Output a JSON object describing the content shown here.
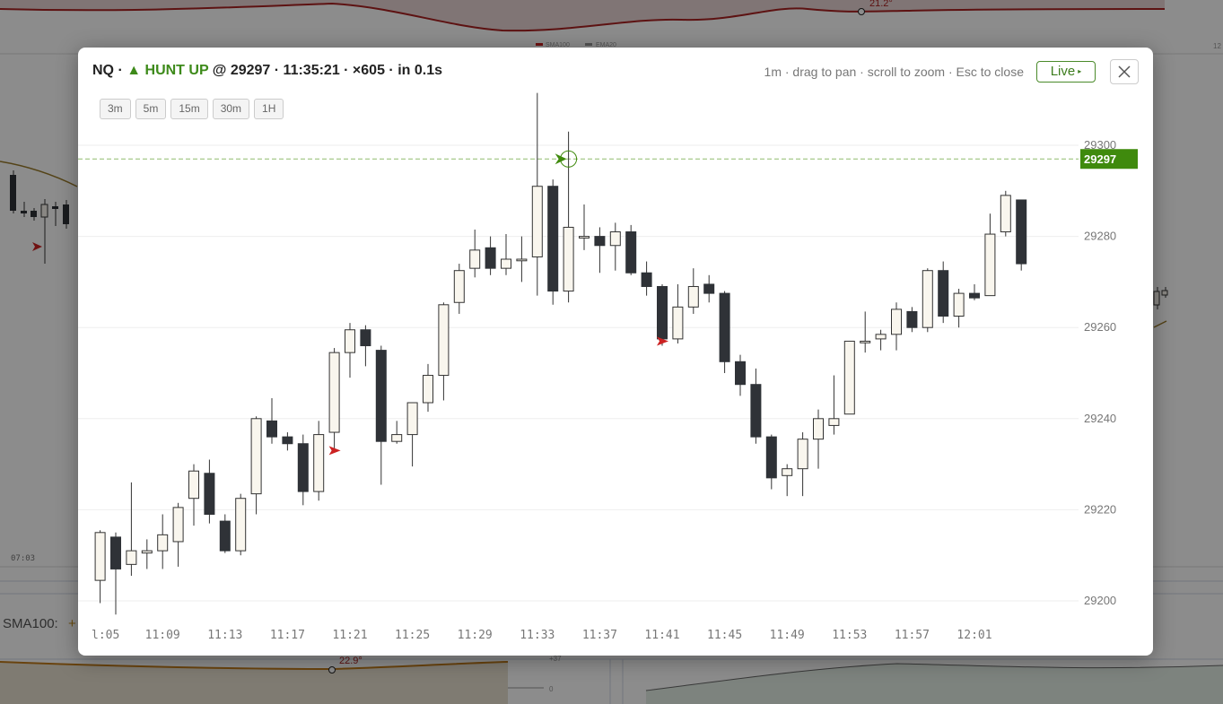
{
  "modal": {
    "symbol": "NQ",
    "dot1": " · ",
    "arrow": "▲",
    "signal": "HUNT UP",
    "price_part": " @ 29297 · 11:35:21 · ×605 · in 0.1s",
    "hint": "1m · drag to pan · scroll to zoom · Esc to close",
    "live_label": "Live",
    "live_icon": "▸",
    "close_icon": "close-icon",
    "timeframes": [
      "3m",
      "5m",
      "15m",
      "30m",
      "1H"
    ]
  },
  "background": {
    "sma_label": "SMA100:",
    "angle_top": "21.2°",
    "angle_bottom": "22.9°",
    "time_label": "07:03",
    "legend1": "SMA100",
    "legend2": "EMA20",
    "small_label": "12",
    "scale_val1": "+37",
    "scale_val2": "0"
  },
  "chart_data": {
    "type": "candlestick",
    "title": "",
    "interval": "1m",
    "y_ticks": [
      29300,
      29280,
      29260,
      29240,
      29220,
      29200
    ],
    "ylim": [
      29200,
      29300
    ],
    "x_tick_labels": [
      ":05",
      "11:09",
      "11:13",
      "11:17",
      "11:21",
      "11:25",
      "11:29",
      "11:33",
      "11:37",
      "11:41",
      "11:45",
      "11:49",
      "11:53",
      "11:57",
      "12:01"
    ],
    "first_x_tick_display": "l:05",
    "current_price": 29297,
    "current_price_label": "29297",
    "candles": [
      {
        "t": "11:05",
        "o": 29204.5,
        "h": 29215.5,
        "l": 29199.5,
        "c": 29215
      },
      {
        "t": "11:06",
        "o": 29214,
        "h": 29215,
        "l": 29197,
        "c": 29207
      },
      {
        "t": "11:07",
        "o": 29208,
        "h": 29226,
        "l": 29205.5,
        "c": 29211
      },
      {
        "t": "11:08",
        "o": 29210.5,
        "h": 29213.5,
        "l": 29207,
        "c": 29211
      },
      {
        "t": "11:09",
        "o": 29211,
        "h": 29219,
        "l": 29207,
        "c": 29214.5
      },
      {
        "t": "11:10",
        "o": 29213,
        "h": 29221.5,
        "l": 29207.5,
        "c": 29220.5
      },
      {
        "t": "11:11",
        "o": 29222.5,
        "h": 29230,
        "l": 29216.5,
        "c": 29228.5
      },
      {
        "t": "11:12",
        "o": 29228,
        "h": 29231,
        "l": 29217,
        "c": 29219
      },
      {
        "t": "11:13",
        "o": 29217.5,
        "h": 29219,
        "l": 29210.5,
        "c": 29211
      },
      {
        "t": "11:14",
        "o": 29211,
        "h": 29223.5,
        "l": 29210,
        "c": 29222.5
      },
      {
        "t": "11:15",
        "o": 29223.5,
        "h": 29240.5,
        "l": 29219,
        "c": 29240
      },
      {
        "t": "11:16",
        "o": 29239.5,
        "h": 29244.5,
        "l": 29234.5,
        "c": 29236
      },
      {
        "t": "11:17",
        "o": 29236,
        "h": 29237,
        "l": 29233,
        "c": 29234.5
      },
      {
        "t": "11:18",
        "o": 29234.5,
        "h": 29236.5,
        "l": 29221,
        "c": 29224
      },
      {
        "t": "11:19",
        "o": 29224,
        "h": 29239.5,
        "l": 29222,
        "c": 29236.5
      },
      {
        "t": "11:20",
        "o": 29237,
        "h": 29255.5,
        "l": 29233,
        "c": 29254.5
      },
      {
        "t": "11:21",
        "o": 29254.5,
        "h": 29261,
        "l": 29249,
        "c": 29259.5
      },
      {
        "t": "11:22",
        "o": 29259.5,
        "h": 29260.5,
        "l": 29251.5,
        "c": 29256
      },
      {
        "t": "11:23",
        "o": 29255,
        "h": 29256,
        "l": 29225.5,
        "c": 29235
      },
      {
        "t": "11:24",
        "o": 29235,
        "h": 29239.5,
        "l": 29234.5,
        "c": 29236.5
      },
      {
        "t": "11:25",
        "o": 29236.5,
        "h": 29241.5,
        "l": 29229.5,
        "c": 29243.5
      },
      {
        "t": "11:26",
        "o": 29243.5,
        "h": 29252,
        "l": 29241.5,
        "c": 29249.5
      },
      {
        "t": "11:27",
        "o": 29249.5,
        "h": 29265.5,
        "l": 29244,
        "c": 29265
      },
      {
        "t": "11:28",
        "o": 29265.5,
        "h": 29274,
        "l": 29263,
        "c": 29272.5
      },
      {
        "t": "11:29",
        "o": 29273,
        "h": 29281.5,
        "l": 29271,
        "c": 29277
      },
      {
        "t": "11:30",
        "o": 29277.5,
        "h": 29280,
        "l": 29271.5,
        "c": 29273
      },
      {
        "t": "11:31",
        "o": 29273,
        "h": 29280.5,
        "l": 29271.5,
        "c": 29275
      },
      {
        "t": "11:32",
        "o": 29275,
        "h": 29280,
        "l": 29270,
        "c": 29275
      },
      {
        "t": "11:33",
        "o": 29275.5,
        "h": 29311.5,
        "l": 29267,
        "c": 29291
      },
      {
        "t": "11:34",
        "o": 29291,
        "h": 29292.5,
        "l": 29265,
        "c": 29268
      },
      {
        "t": "11:35",
        "o": 29268,
        "h": 29303,
        "l": 29265.5,
        "c": 29282
      },
      {
        "t": "11:36",
        "o": 29280,
        "h": 29287,
        "l": 29277,
        "c": 29280
      },
      {
        "t": "11:37",
        "o": 29280,
        "h": 29282,
        "l": 29272,
        "c": 29278
      },
      {
        "t": "11:38",
        "o": 29278,
        "h": 29283,
        "l": 29272.5,
        "c": 29281
      },
      {
        "t": "11:39",
        "o": 29281,
        "h": 29282.5,
        "l": 29271.5,
        "c": 29272
      },
      {
        "t": "11:40",
        "o": 29272,
        "h": 29274.5,
        "l": 29267,
        "c": 29269
      },
      {
        "t": "11:41",
        "o": 29269,
        "h": 29269.5,
        "l": 29256,
        "c": 29257.5
      },
      {
        "t": "11:42",
        "o": 29257.5,
        "h": 29269.5,
        "l": 29256.5,
        "c": 29264.5
      },
      {
        "t": "11:43",
        "o": 29264.5,
        "h": 29273,
        "l": 29263,
        "c": 29269
      },
      {
        "t": "11:44",
        "o": 29269.5,
        "h": 29271.5,
        "l": 29265.5,
        "c": 29267.5
      },
      {
        "t": "11:45",
        "o": 29267.5,
        "h": 29268,
        "l": 29250,
        "c": 29252.5
      },
      {
        "t": "11:46",
        "o": 29252.5,
        "h": 29254,
        "l": 29245,
        "c": 29247.5
      },
      {
        "t": "11:47",
        "o": 29247.5,
        "h": 29251,
        "l": 29234.5,
        "c": 29236
      },
      {
        "t": "11:48",
        "o": 29236,
        "h": 29236.5,
        "l": 29224.5,
        "c": 29227
      },
      {
        "t": "11:49",
        "o": 29227.5,
        "h": 29230,
        "l": 29223,
        "c": 29229
      },
      {
        "t": "11:50",
        "o": 29229,
        "h": 29237,
        "l": 29223,
        "c": 29235.5
      },
      {
        "t": "11:51",
        "o": 29235.5,
        "h": 29242,
        "l": 29229,
        "c": 29240
      },
      {
        "t": "11:52",
        "o": 29238.5,
        "h": 29249.5,
        "l": 29236.5,
        "c": 29240
      },
      {
        "t": "11:53",
        "o": 29241,
        "h": 29257,
        "l": 29241,
        "c": 29257
      },
      {
        "t": "11:54",
        "o": 29257,
        "h": 29263.5,
        "l": 29254.5,
        "c": 29257
      },
      {
        "t": "11:55",
        "o": 29257.5,
        "h": 29259.5,
        "l": 29255,
        "c": 29258.5
      },
      {
        "t": "11:56",
        "o": 29258.5,
        "h": 29265.5,
        "l": 29255,
        "c": 29264
      },
      {
        "t": "11:57",
        "o": 29263.5,
        "h": 29264.5,
        "l": 29259,
        "c": 29260
      },
      {
        "t": "11:58",
        "o": 29260,
        "h": 29273,
        "l": 29259,
        "c": 29272.5
      },
      {
        "t": "11:59",
        "o": 29272.5,
        "h": 29274.5,
        "l": 29261,
        "c": 29262.5
      },
      {
        "t": "12:00",
        "o": 29262.5,
        "h": 29268.5,
        "l": 29260,
        "c": 29267.5
      },
      {
        "t": "12:01",
        "o": 29267.5,
        "h": 29269.5,
        "l": 29266,
        "c": 29266.5
      },
      {
        "t": "12:02",
        "o": 29267,
        "h": 29285,
        "l": 29267,
        "c": 29280.5
      },
      {
        "t": "12:03",
        "o": 29281,
        "h": 29290,
        "l": 29280,
        "c": 29289
      },
      {
        "t": "12:04",
        "o": 29288,
        "h": 29288,
        "l": 29272.5,
        "c": 29274
      }
    ],
    "markers": [
      {
        "t": "11:20",
        "price": 29233,
        "kind": "red-arrow"
      },
      {
        "t": "11:41",
        "price": 29257,
        "kind": "red-arrow"
      },
      {
        "t": "11:35",
        "price": 29297,
        "kind": "green-signal"
      }
    ],
    "colors": {
      "up_fill": "#f9f6ee",
      "down_fill": "#2f3237",
      "wick": "#333333",
      "price_line": "#8fbb6e",
      "price_tag": "#3f8a0d",
      "signal": "#3f8a0d",
      "marker_red": "#cc2222",
      "grid": "#eeeeee",
      "axis_text": "#777777"
    }
  }
}
